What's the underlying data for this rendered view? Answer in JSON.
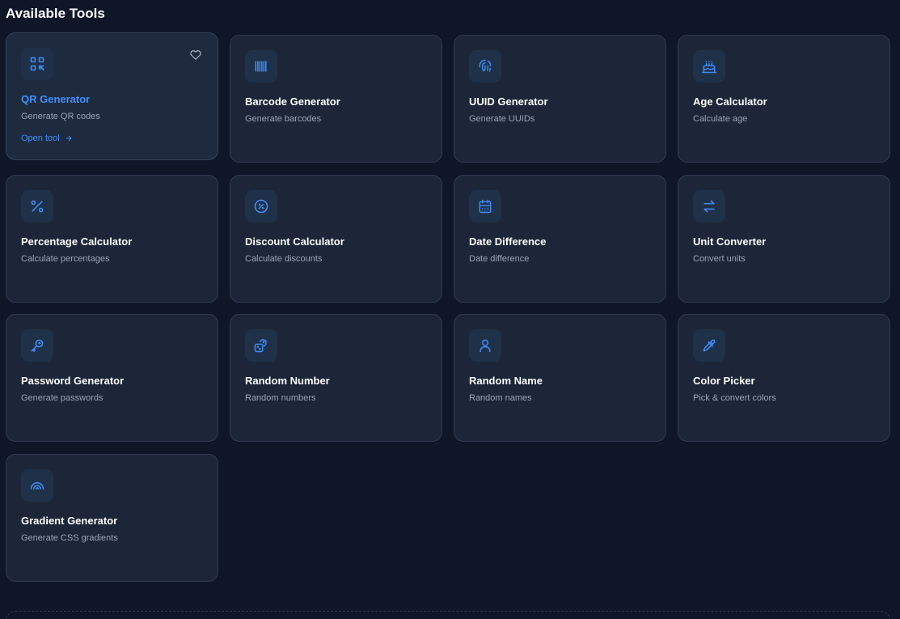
{
  "section": {
    "title": "Available Tools"
  },
  "open_tool_label": "Open tool",
  "accent_color": "#3f8efc",
  "tools": [
    {
      "name": "QR Generator",
      "desc": "Generate QR codes",
      "icon": "qr-code-icon"
    },
    {
      "name": "Barcode Generator",
      "desc": "Generate barcodes",
      "icon": "barcode-icon"
    },
    {
      "name": "UUID Generator",
      "desc": "Generate UUIDs",
      "icon": "fingerprint-icon"
    },
    {
      "name": "Age Calculator",
      "desc": "Calculate age",
      "icon": "cake-icon"
    },
    {
      "name": "Percentage Calculator",
      "desc": "Calculate percentages",
      "icon": "percent-icon"
    },
    {
      "name": "Discount Calculator",
      "desc": "Calculate discounts",
      "icon": "discount-icon"
    },
    {
      "name": "Date Difference",
      "desc": "Date difference",
      "icon": "calendar-icon"
    },
    {
      "name": "Unit Converter",
      "desc": "Convert units",
      "icon": "arrows-exchange-icon"
    },
    {
      "name": "Password Generator",
      "desc": "Generate passwords",
      "icon": "key-icon"
    },
    {
      "name": "Random Number",
      "desc": "Random numbers",
      "icon": "dice-icon"
    },
    {
      "name": "Random Name",
      "desc": "Random names",
      "icon": "user-icon"
    },
    {
      "name": "Color Picker",
      "desc": "Pick & convert colors",
      "icon": "eyedropper-icon"
    },
    {
      "name": "Gradient Generator",
      "desc": "Generate CSS gradients",
      "icon": "rainbow-icon"
    }
  ]
}
